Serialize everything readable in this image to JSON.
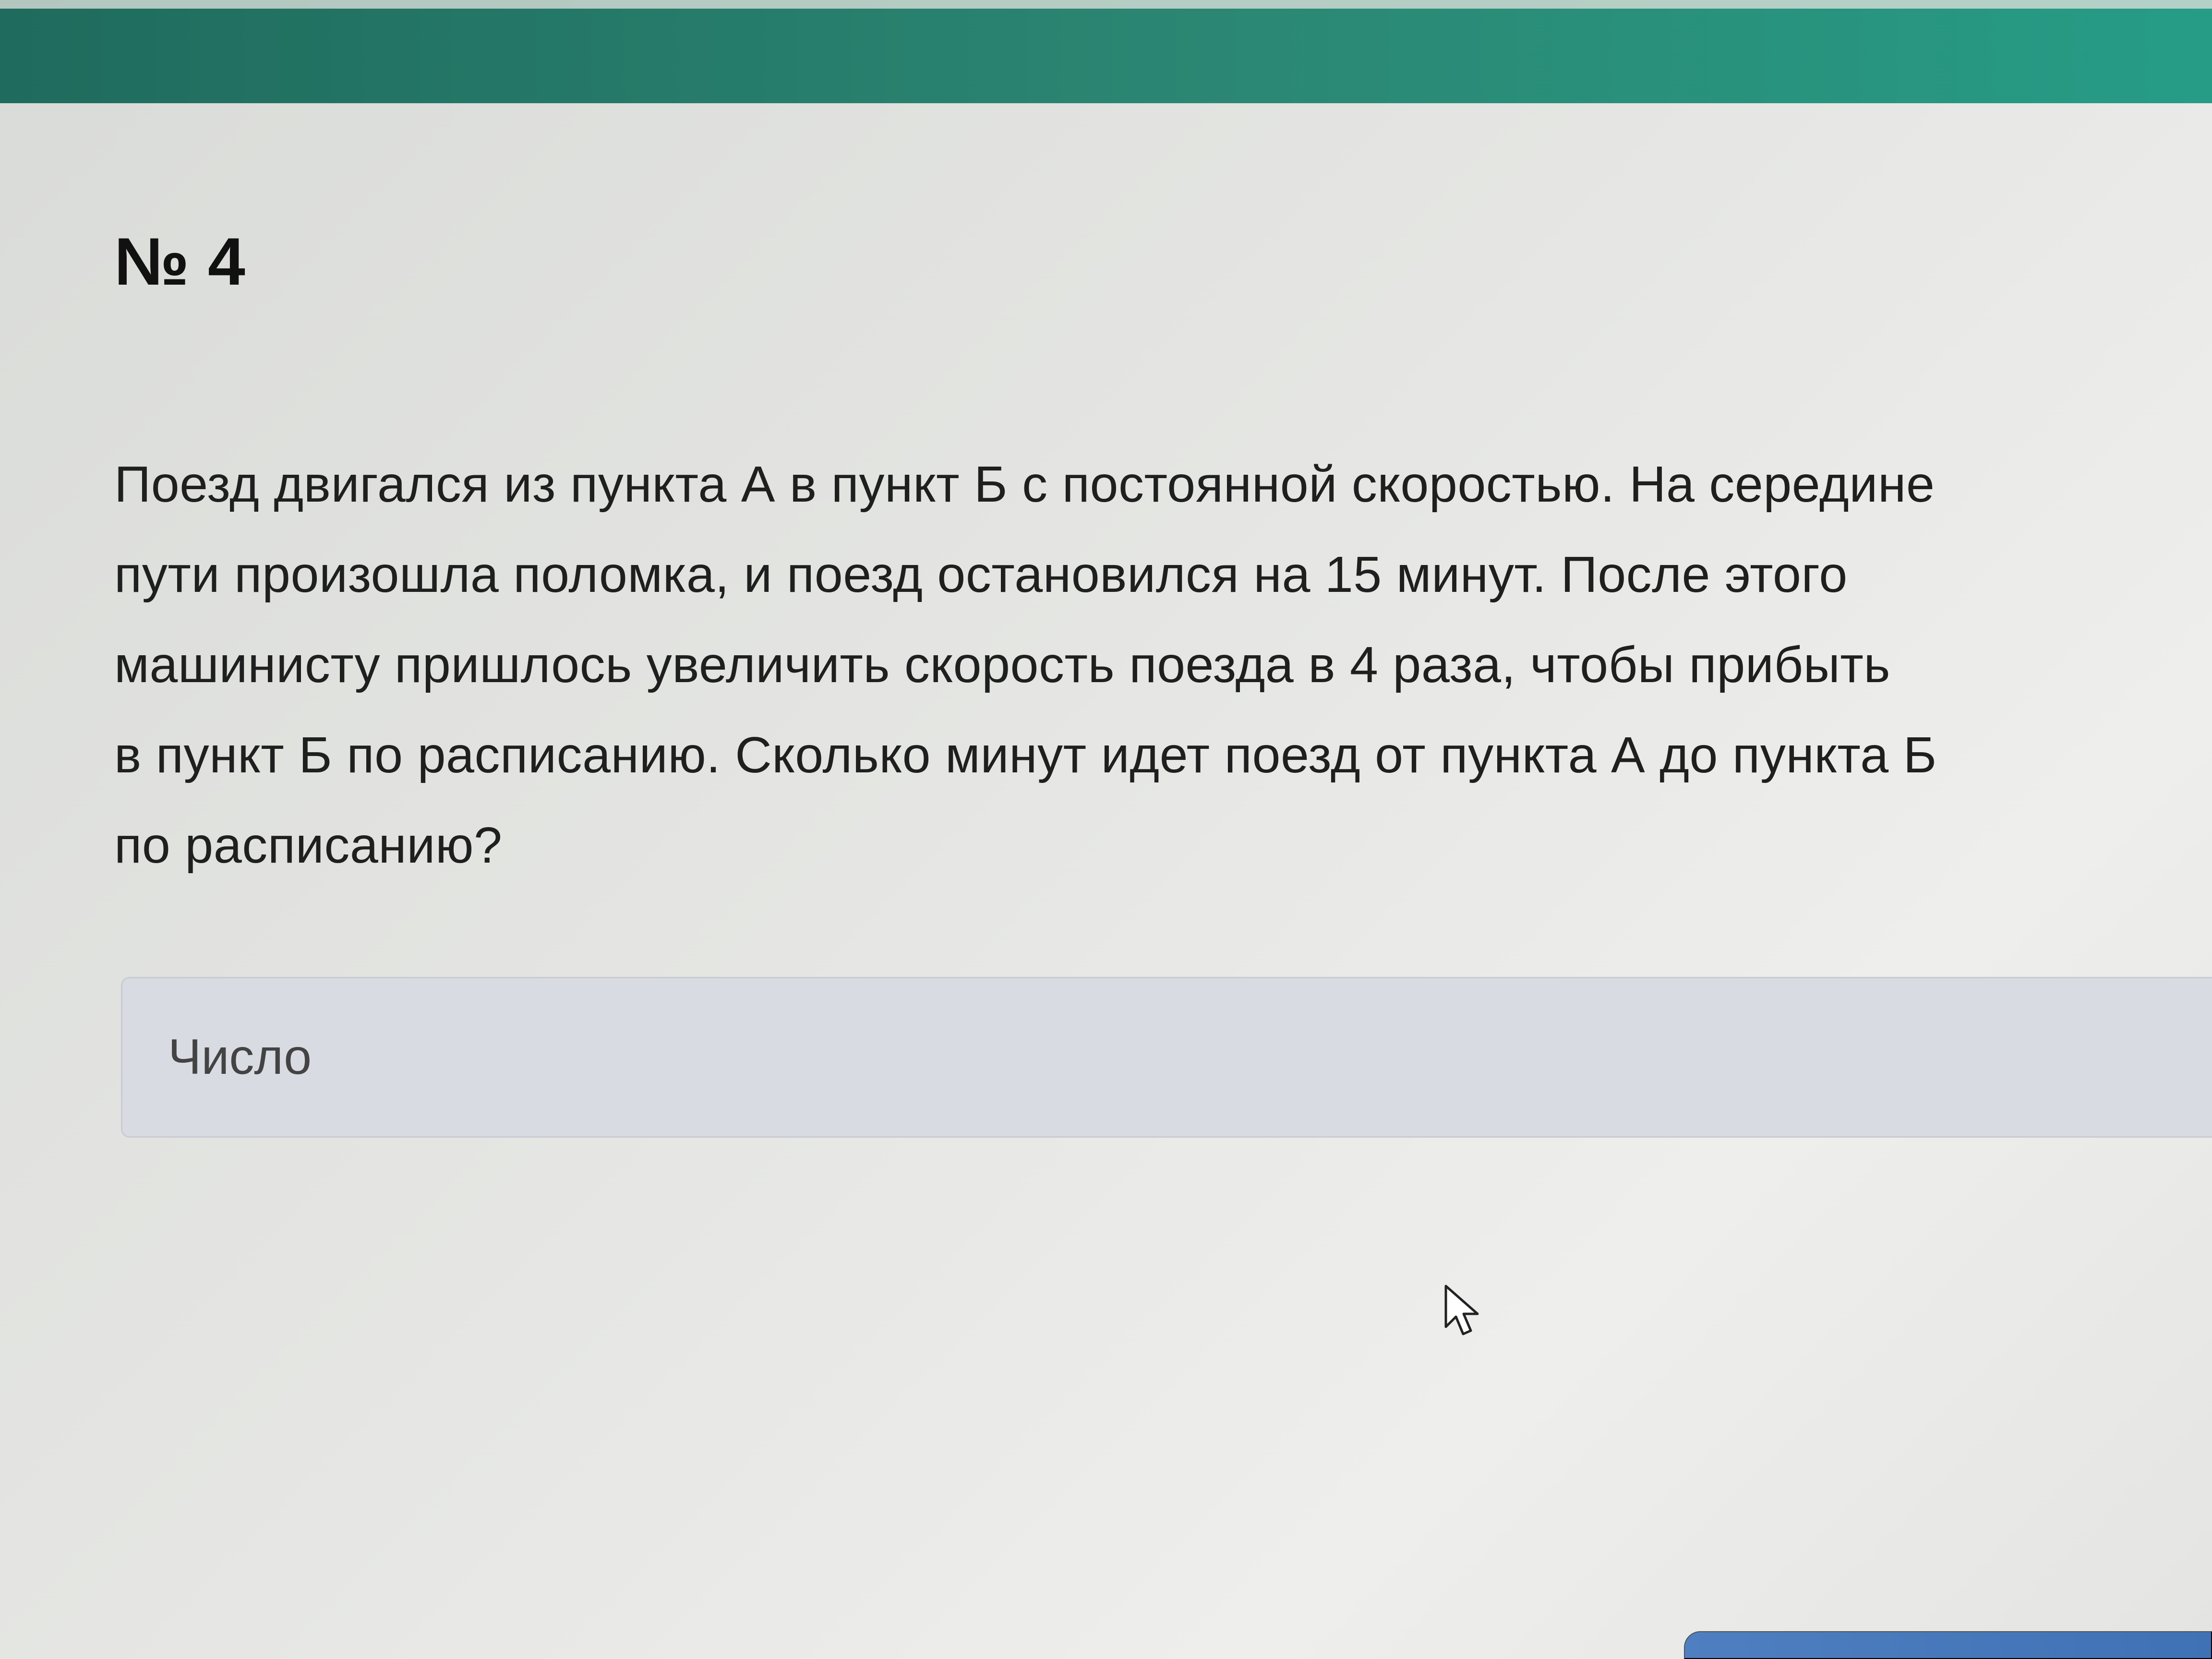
{
  "task": {
    "number_label": "№ 4"
  },
  "problem": {
    "lines": [
      "Поезд двигался из пункта А в пункт Б с постоянной скоростью. На середине",
      "пути произошла поломка, и поезд остановился на 15 минут. После этого",
      "машинисту пришлось увеличить скорость поезда в 4 раза, чтобы прибыть",
      "в пункт Б по расписанию. Сколько минут идет поезд от пункта А до пункта Б",
      "по расписанию?"
    ]
  },
  "answer": {
    "placeholder": "Число",
    "value": ""
  },
  "icons": {
    "cursor": "mouse-pointer-icon"
  },
  "colors": {
    "header": "#2b8773",
    "field_background": "#d9dbe2",
    "button": "#4f7fc0"
  }
}
